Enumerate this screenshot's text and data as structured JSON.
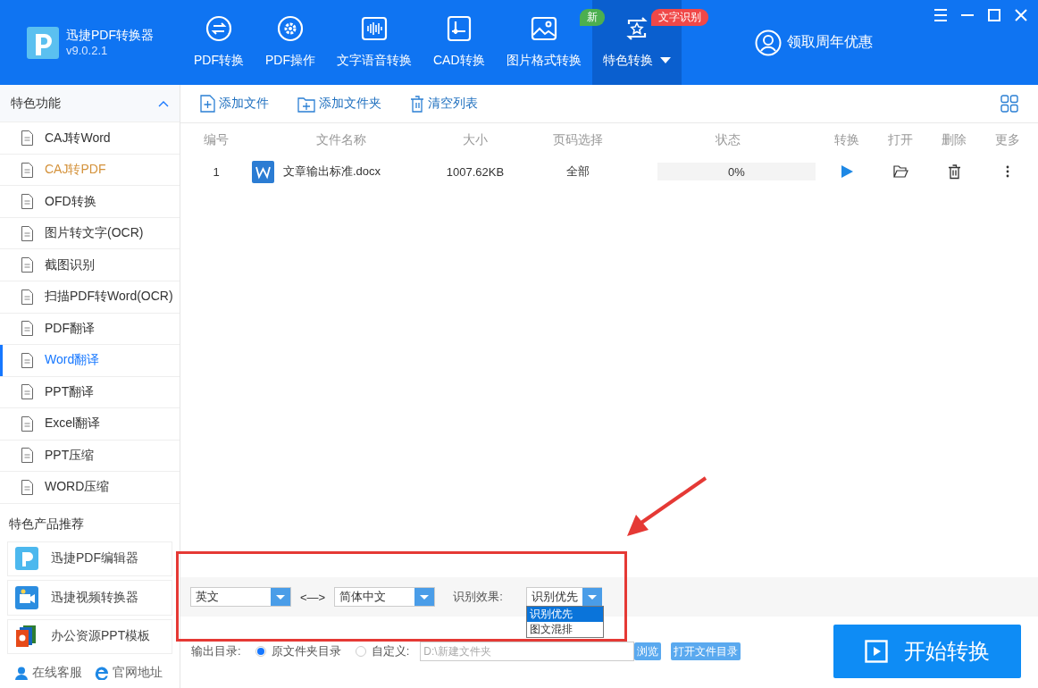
{
  "app": {
    "title": "迅捷PDF转换器",
    "version": "v9.0.2.1"
  },
  "nav": [
    {
      "label": "PDF转换",
      "selected": false
    },
    {
      "label": "PDF操作",
      "selected": false
    },
    {
      "label": "文字语音转换",
      "selected": false
    },
    {
      "label": "CAD转换",
      "selected": false
    },
    {
      "label": "图片格式转换",
      "selected": false,
      "badge": {
        "text": "新",
        "color": "#4caf50"
      }
    },
    {
      "label": "特色转换",
      "selected": true,
      "badge": {
        "text": "文字识别",
        "color": "#f04848"
      }
    }
  ],
  "promo": "领取周年优惠",
  "sidebar": {
    "title": "特色功能",
    "expanded": true,
    "items": [
      {
        "label": "CAJ转Word",
        "selected": false,
        "hovered": false
      },
      {
        "label": "CAJ转PDF",
        "selected": false,
        "hovered": true
      },
      {
        "label": "OFD转换",
        "selected": false,
        "hovered": false
      },
      {
        "label": "图片转文字(OCR)",
        "selected": false,
        "hovered": false
      },
      {
        "label": "截图识别",
        "selected": false,
        "hovered": false
      },
      {
        "label": "扫描PDF转Word(OCR)",
        "selected": false,
        "hovered": false
      },
      {
        "label": "PDF翻译",
        "selected": false,
        "hovered": false
      },
      {
        "label": "Word翻译",
        "selected": true,
        "hovered": false
      },
      {
        "label": "PPT翻译",
        "selected": false,
        "hovered": false
      },
      {
        "label": "Excel翻译",
        "selected": false,
        "hovered": false
      },
      {
        "label": "PPT压缩",
        "selected": false,
        "hovered": false
      },
      {
        "label": "WORD压缩",
        "selected": false,
        "hovered": false
      }
    ],
    "products_title": "特色产品推荐",
    "products": [
      "迅捷PDF编辑器",
      "迅捷视频转换器",
      "办公资源PPT模板"
    ],
    "links": [
      "在线客服",
      "官网地址"
    ]
  },
  "toolbar": [
    "添加文件",
    "添加文件夹",
    "清空列表"
  ],
  "table": {
    "columns": [
      "编号",
      "文件名称",
      "大小",
      "页码选择",
      "状态",
      "转换",
      "打开",
      "删除",
      "更多"
    ],
    "rows": [
      {
        "number": "1",
        "name": "文章输出标准.docx",
        "size": "1007.62KB",
        "pages": "全部",
        "level": 0,
        "reading": "0%"
      }
    ]
  },
  "translation": {
    "source": "英文",
    "swap": "<—>",
    "target": "简体中文",
    "effect_label": "识别效果:",
    "effect_value": "识别优先",
    "effect_open": true,
    "effect_options": [
      {
        "label": "识别优先",
        "selected": true
      },
      {
        "label": "图文混排",
        "selected": false
      }
    ]
  },
  "output": {
    "label": "输出目录:",
    "options": [
      {
        "label": "原文件夹目录",
        "selected": true
      },
      {
        "label": "自定义:",
        "selected": false
      }
    ],
    "path_placeholder": "D:\\新建文件夹",
    "browse": "浏览",
    "open_folder": "打开文件目录"
  },
  "start_button": "开始转换"
}
